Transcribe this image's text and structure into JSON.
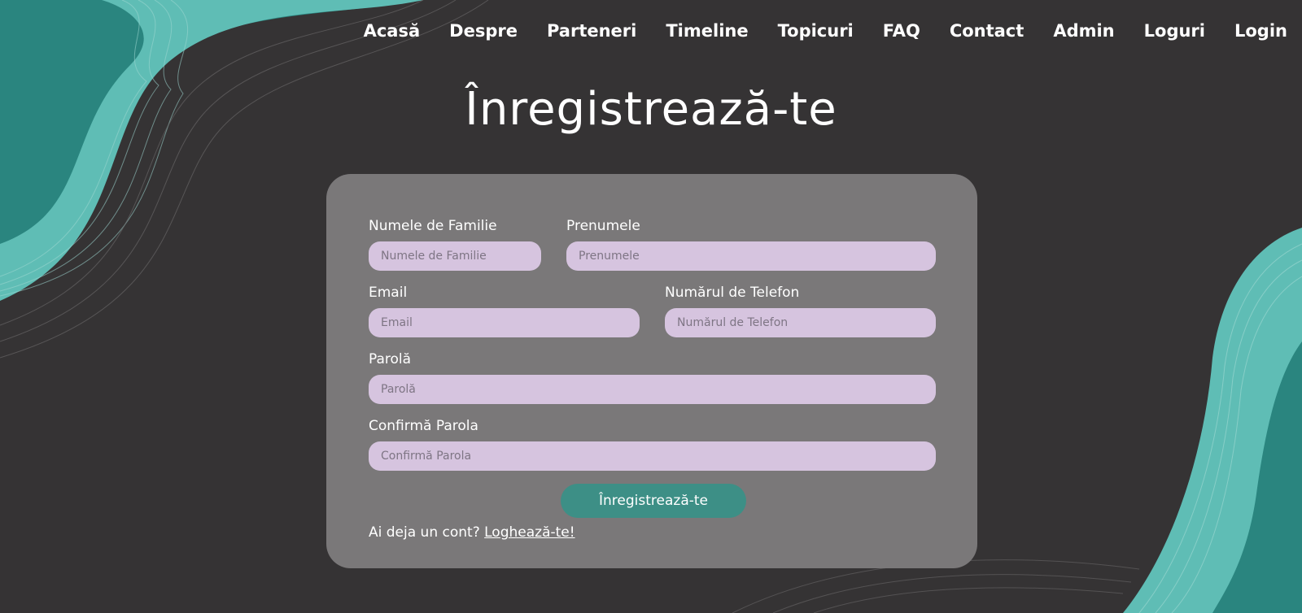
{
  "nav": {
    "items": [
      "Acasă",
      "Despre",
      "Parteneri",
      "Timeline",
      "Topicuri",
      "FAQ",
      "Contact",
      "Admin",
      "Loguri",
      "Login"
    ]
  },
  "page": {
    "title": "Înregistrează-te"
  },
  "form": {
    "last_name": {
      "label": "Numele de Familie",
      "placeholder": "Numele de Familie"
    },
    "first_name": {
      "label": "Prenumele",
      "placeholder": "Prenumele"
    },
    "email": {
      "label": "Email",
      "placeholder": "Email"
    },
    "phone": {
      "label": "Numărul de Telefon",
      "placeholder": "Numărul de Telefon"
    },
    "password": {
      "label": "Parolă",
      "placeholder": "Parolă"
    },
    "confirm_password": {
      "label": "Confirmă Parola",
      "placeholder": "Confirmă Parola"
    },
    "submit_label": "Înregistrează-te",
    "login_prompt": "Ai deja un cont?",
    "login_link": "Loghează-te!"
  },
  "colors": {
    "background": "#353334",
    "card": "#7a7879",
    "input": "#d6c4df",
    "accent": "#3d8f86",
    "wave_teal": "#5fbdb5",
    "wave_dark_teal": "#2a857f"
  }
}
